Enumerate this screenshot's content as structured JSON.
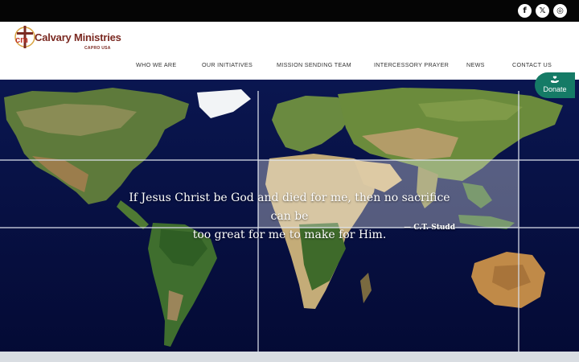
{
  "topbar": {
    "social": [
      {
        "icon": "facebook-icon",
        "glyph": "f"
      },
      {
        "icon": "x-twitter-icon",
        "glyph": "𝕏"
      },
      {
        "icon": "instagram-icon",
        "glyph": "◎"
      }
    ]
  },
  "logo": {
    "mark": "cm",
    "name": "Calvary Ministries",
    "sub": "CAPRO USA"
  },
  "nav": {
    "items": [
      {
        "label": "WHO WE ARE"
      },
      {
        "label": "OUR INITIATIVES"
      },
      {
        "label": "MISSION SENDING TEAM"
      },
      {
        "label": "INTERCESSORY PRAYER"
      },
      {
        "label": "NEWS"
      },
      {
        "label": "CONTACT US"
      }
    ]
  },
  "hero": {
    "quote_line1": "If Jesus Christ be God and died for me, then no sacrifice can be",
    "quote_line2": "too great for me to make for Him.",
    "cite": "— C.T. Studd"
  },
  "donate": {
    "label": "Donate",
    "icon": "hand-heart-icon"
  },
  "colors": {
    "topbar": "#050505",
    "brand": "#7b2a22",
    "donate": "#157b66",
    "ocean": "#050c3a"
  }
}
